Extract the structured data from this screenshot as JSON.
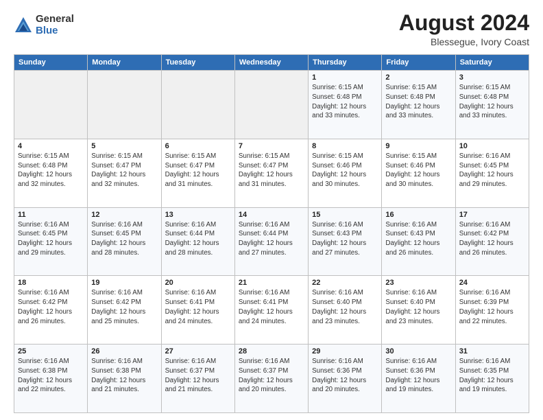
{
  "logo": {
    "general": "General",
    "blue": "Blue"
  },
  "header": {
    "title": "August 2024",
    "subtitle": "Blessegue, Ivory Coast"
  },
  "weekdays": [
    "Sunday",
    "Monday",
    "Tuesday",
    "Wednesday",
    "Thursday",
    "Friday",
    "Saturday"
  ],
  "weeks": [
    [
      {
        "day": "",
        "info": ""
      },
      {
        "day": "",
        "info": ""
      },
      {
        "day": "",
        "info": ""
      },
      {
        "day": "",
        "info": ""
      },
      {
        "day": "1",
        "info": "Sunrise: 6:15 AM\nSunset: 6:48 PM\nDaylight: 12 hours\nand 33 minutes."
      },
      {
        "day": "2",
        "info": "Sunrise: 6:15 AM\nSunset: 6:48 PM\nDaylight: 12 hours\nand 33 minutes."
      },
      {
        "day": "3",
        "info": "Sunrise: 6:15 AM\nSunset: 6:48 PM\nDaylight: 12 hours\nand 33 minutes."
      }
    ],
    [
      {
        "day": "4",
        "info": "Sunrise: 6:15 AM\nSunset: 6:48 PM\nDaylight: 12 hours\nand 32 minutes."
      },
      {
        "day": "5",
        "info": "Sunrise: 6:15 AM\nSunset: 6:47 PM\nDaylight: 12 hours\nand 32 minutes."
      },
      {
        "day": "6",
        "info": "Sunrise: 6:15 AM\nSunset: 6:47 PM\nDaylight: 12 hours\nand 31 minutes."
      },
      {
        "day": "7",
        "info": "Sunrise: 6:15 AM\nSunset: 6:47 PM\nDaylight: 12 hours\nand 31 minutes."
      },
      {
        "day": "8",
        "info": "Sunrise: 6:15 AM\nSunset: 6:46 PM\nDaylight: 12 hours\nand 30 minutes."
      },
      {
        "day": "9",
        "info": "Sunrise: 6:15 AM\nSunset: 6:46 PM\nDaylight: 12 hours\nand 30 minutes."
      },
      {
        "day": "10",
        "info": "Sunrise: 6:16 AM\nSunset: 6:45 PM\nDaylight: 12 hours\nand 29 minutes."
      }
    ],
    [
      {
        "day": "11",
        "info": "Sunrise: 6:16 AM\nSunset: 6:45 PM\nDaylight: 12 hours\nand 29 minutes."
      },
      {
        "day": "12",
        "info": "Sunrise: 6:16 AM\nSunset: 6:45 PM\nDaylight: 12 hours\nand 28 minutes."
      },
      {
        "day": "13",
        "info": "Sunrise: 6:16 AM\nSunset: 6:44 PM\nDaylight: 12 hours\nand 28 minutes."
      },
      {
        "day": "14",
        "info": "Sunrise: 6:16 AM\nSunset: 6:44 PM\nDaylight: 12 hours\nand 27 minutes."
      },
      {
        "day": "15",
        "info": "Sunrise: 6:16 AM\nSunset: 6:43 PM\nDaylight: 12 hours\nand 27 minutes."
      },
      {
        "day": "16",
        "info": "Sunrise: 6:16 AM\nSunset: 6:43 PM\nDaylight: 12 hours\nand 26 minutes."
      },
      {
        "day": "17",
        "info": "Sunrise: 6:16 AM\nSunset: 6:42 PM\nDaylight: 12 hours\nand 26 minutes."
      }
    ],
    [
      {
        "day": "18",
        "info": "Sunrise: 6:16 AM\nSunset: 6:42 PM\nDaylight: 12 hours\nand 26 minutes."
      },
      {
        "day": "19",
        "info": "Sunrise: 6:16 AM\nSunset: 6:42 PM\nDaylight: 12 hours\nand 25 minutes."
      },
      {
        "day": "20",
        "info": "Sunrise: 6:16 AM\nSunset: 6:41 PM\nDaylight: 12 hours\nand 24 minutes."
      },
      {
        "day": "21",
        "info": "Sunrise: 6:16 AM\nSunset: 6:41 PM\nDaylight: 12 hours\nand 24 minutes."
      },
      {
        "day": "22",
        "info": "Sunrise: 6:16 AM\nSunset: 6:40 PM\nDaylight: 12 hours\nand 23 minutes."
      },
      {
        "day": "23",
        "info": "Sunrise: 6:16 AM\nSunset: 6:40 PM\nDaylight: 12 hours\nand 23 minutes."
      },
      {
        "day": "24",
        "info": "Sunrise: 6:16 AM\nSunset: 6:39 PM\nDaylight: 12 hours\nand 22 minutes."
      }
    ],
    [
      {
        "day": "25",
        "info": "Sunrise: 6:16 AM\nSunset: 6:38 PM\nDaylight: 12 hours\nand 22 minutes."
      },
      {
        "day": "26",
        "info": "Sunrise: 6:16 AM\nSunset: 6:38 PM\nDaylight: 12 hours\nand 21 minutes."
      },
      {
        "day": "27",
        "info": "Sunrise: 6:16 AM\nSunset: 6:37 PM\nDaylight: 12 hours\nand 21 minutes."
      },
      {
        "day": "28",
        "info": "Sunrise: 6:16 AM\nSunset: 6:37 PM\nDaylight: 12 hours\nand 20 minutes."
      },
      {
        "day": "29",
        "info": "Sunrise: 6:16 AM\nSunset: 6:36 PM\nDaylight: 12 hours\nand 20 minutes."
      },
      {
        "day": "30",
        "info": "Sunrise: 6:16 AM\nSunset: 6:36 PM\nDaylight: 12 hours\nand 19 minutes."
      },
      {
        "day": "31",
        "info": "Sunrise: 6:16 AM\nSunset: 6:35 PM\nDaylight: 12 hours\nand 19 minutes."
      }
    ]
  ]
}
